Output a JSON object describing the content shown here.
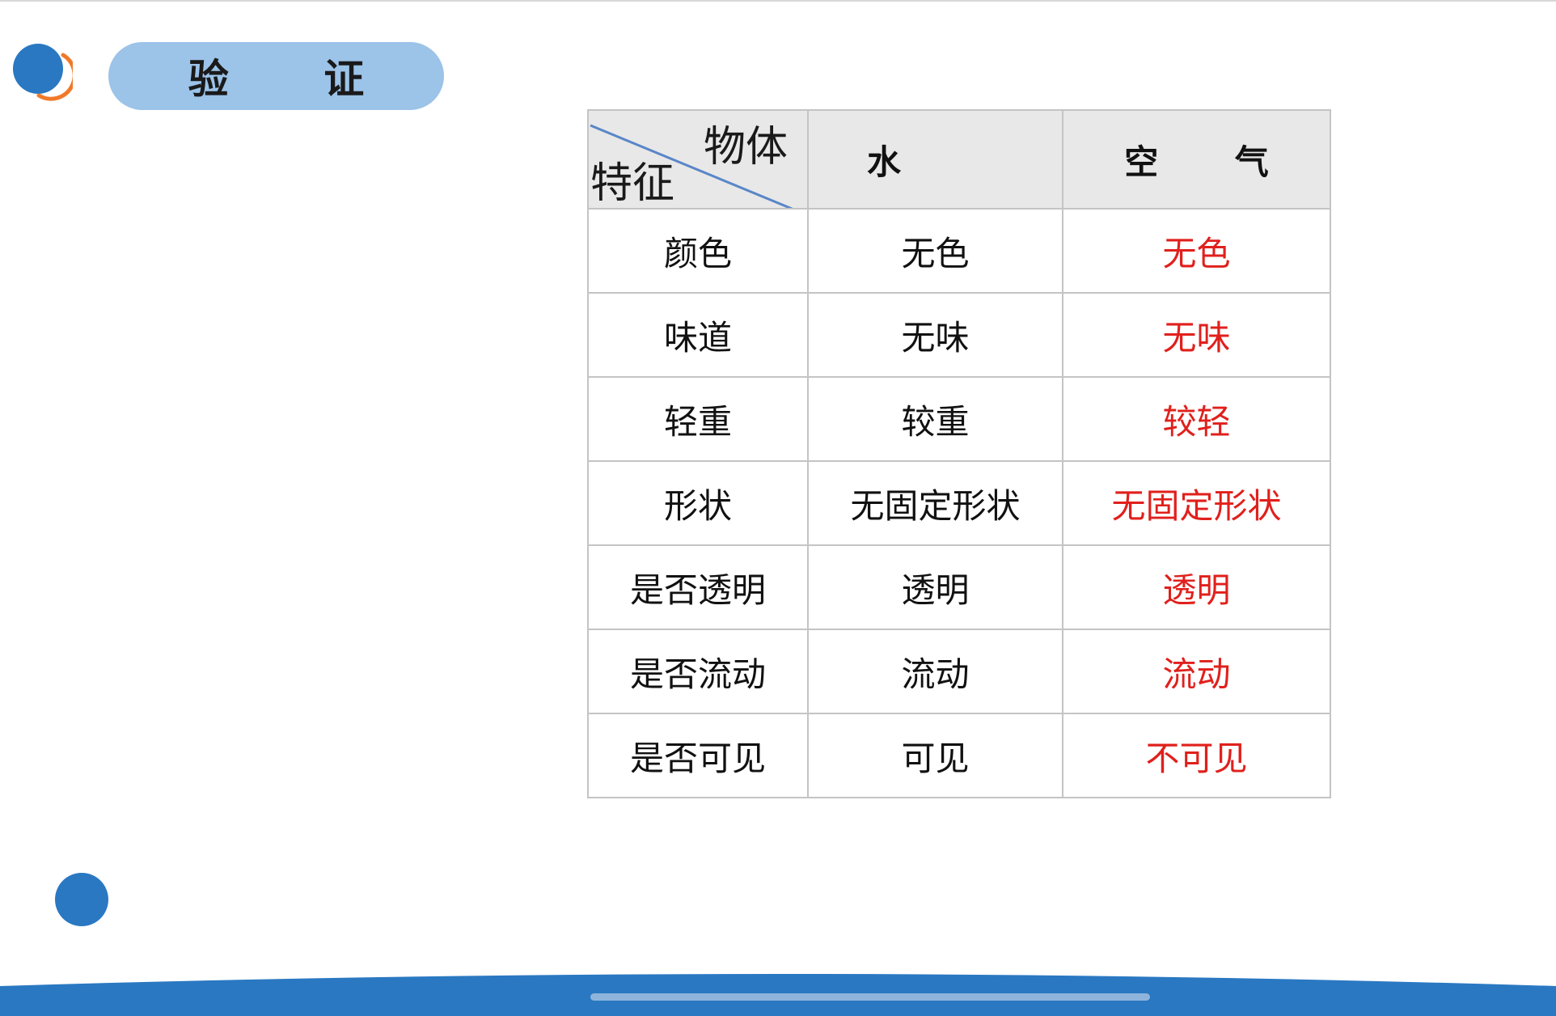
{
  "slide": {
    "title": "验  证"
  },
  "table": {
    "corner_top": "物体",
    "corner_bottom": "特征",
    "headers": [
      "水",
      "空 气"
    ],
    "rows": [
      {
        "feature": "颜色",
        "water": "无色",
        "air": "无色"
      },
      {
        "feature": "味道",
        "water": "无味",
        "air": "无味"
      },
      {
        "feature": "轻重",
        "water": "较重",
        "air": "较轻"
      },
      {
        "feature": "形状",
        "water": "无固定形状",
        "air": "无固定形状"
      },
      {
        "feature": "是否透明",
        "water": "透明",
        "air": "透明"
      },
      {
        "feature": "是否流动",
        "water": "流动",
        "air": "流动"
      },
      {
        "feature": "是否可见",
        "water": "可见",
        "air": "不可见"
      }
    ]
  },
  "colors": {
    "accent_blue": "#2a78c2",
    "pill_blue": "#9cc3e8",
    "answer_red": "#e0201c",
    "arc_orange": "#f07a2a"
  }
}
